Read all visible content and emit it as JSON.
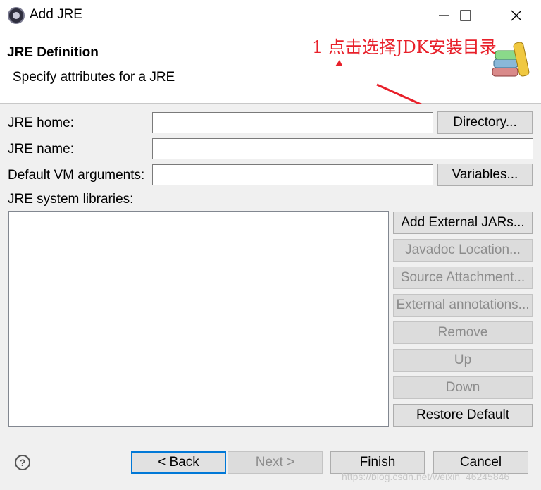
{
  "window": {
    "title": "Add JRE",
    "minimize": "—",
    "maximize": "☐",
    "close": "✕"
  },
  "header": {
    "title": "JRE Definition",
    "subtitle": "Specify attributes for a JRE"
  },
  "annotation": {
    "text": "1 点击选择JDK安装目录",
    "color": "#e8202a"
  },
  "form": {
    "jre_home": {
      "label": "JRE home:",
      "value": ""
    },
    "jre_name": {
      "label": "JRE name:",
      "value": ""
    },
    "vm_args": {
      "label": "Default VM arguments:",
      "value": ""
    },
    "directory_button": "Directory...",
    "variables_button": "Variables...",
    "libraries_label": "JRE system libraries:"
  },
  "library_buttons": {
    "add_external_jars": "Add External JARs...",
    "javadoc_location": "Javadoc Location...",
    "source_attachment": "Source Attachment...",
    "external_annotations": "External annotations...",
    "remove": "Remove",
    "up": "Up",
    "down": "Down",
    "restore_default": "Restore Default"
  },
  "footer": {
    "help": "?",
    "back": "< Back",
    "next": "Next >",
    "finish": "Finish",
    "cancel": "Cancel"
  },
  "watermark": "https://blog.csdn.net/weixin_46245846"
}
